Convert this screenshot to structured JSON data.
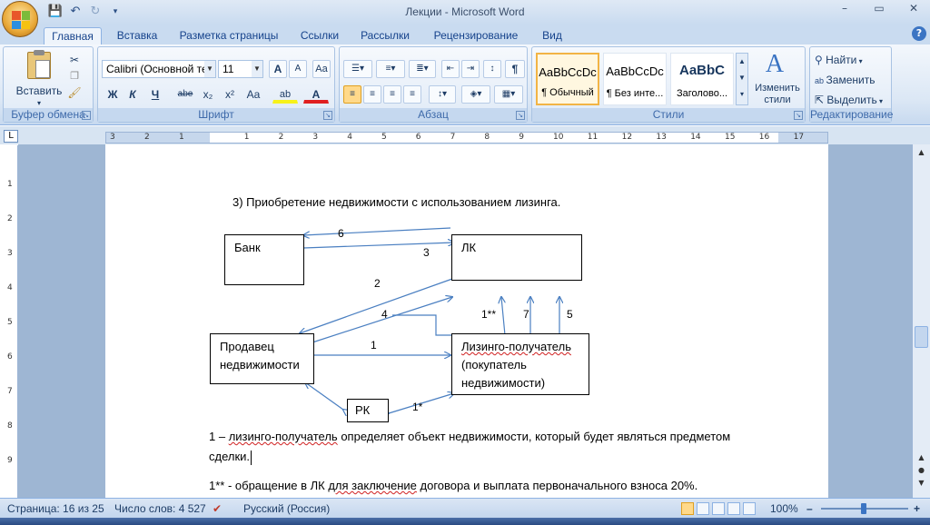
{
  "window": {
    "title": "Лекции - Microsoft Word",
    "controls": [
      "–",
      "▭",
      "✕"
    ]
  },
  "qat": {
    "save_icon": "💾",
    "undo_icon": "↶",
    "redo_icon": "↻",
    "more_icon": "▾"
  },
  "tabs": [
    "Главная",
    "Вставка",
    "Разметка страницы",
    "Ссылки",
    "Рассылки",
    "Рецензирование",
    "Вид"
  ],
  "help_label": "?",
  "ribbon": {
    "clipboard": {
      "label": "Буфер обмена",
      "paste_label": "Вставить"
    },
    "font": {
      "label": "Шрифт",
      "font_name": "Calibri (Основной те",
      "font_size": "11",
      "buttons": [
        "Ж",
        "К",
        "Ч",
        "abe",
        "x₂",
        "x²",
        "Aa"
      ],
      "grow": "A",
      "shrink": "A"
    },
    "paragraph": {
      "label": "Абзац",
      "pilcrow": "¶"
    },
    "styles": {
      "label": "Стили",
      "items": [
        {
          "sample": "AaBbCcDc",
          "name": "¶ Обычный"
        },
        {
          "sample": "AaBbCcDc",
          "name": "¶ Без инте..."
        },
        {
          "sample": "AaBbC",
          "name": "Заголово..."
        }
      ],
      "change_styles": "Изменить стили"
    },
    "editing": {
      "label": "Редактирование",
      "find": "Найти",
      "replace": "Заменить",
      "select": "Выделить"
    }
  },
  "ruler_ticks": [
    "3",
    "2",
    "1",
    "1",
    "2",
    "3",
    "4",
    "5",
    "6",
    "7",
    "8",
    "9",
    "10",
    "11",
    "12",
    "13",
    "14",
    "15",
    "16",
    "17"
  ],
  "document": {
    "heading": "3)    Приобретение недвижимости с использованием лизинга.",
    "boxes": {
      "bank": "Банк",
      "lk": "ЛК",
      "seller_line1": "Продавец",
      "seller_line2": "недвижимости",
      "lessee_line1": "Лизинго-получатель",
      "lessee_line2": "(покупатель",
      "lessee_line3": "недвижимости)",
      "rk": "РК"
    },
    "arrow_labels": {
      "a6": "6",
      "a3": "3",
      "a2": "2",
      "a4": "4",
      "a1": "1",
      "a1ss": "1**",
      "a7": "7",
      "a5": "5",
      "a1s": "1*"
    },
    "para1_prefix": "1 – ",
    "para1_err": "лизинго-получатель",
    "para1_rest": " определяет объект недвижимости, который будет являться предметом",
    "para1_line2": "сделки.",
    "para2_prefix": "1** - обращение в ЛК ",
    "para2_u1": "для заключение",
    "para2_rest": " договора и выплата первоначального взноса 20%."
  },
  "status": {
    "page": "Страница: 16 из 25",
    "words": "Число слов: 4 527",
    "language": "Русский (Россия)",
    "zoom": "100%",
    "zoom_minus": "–",
    "zoom_plus": "+"
  }
}
